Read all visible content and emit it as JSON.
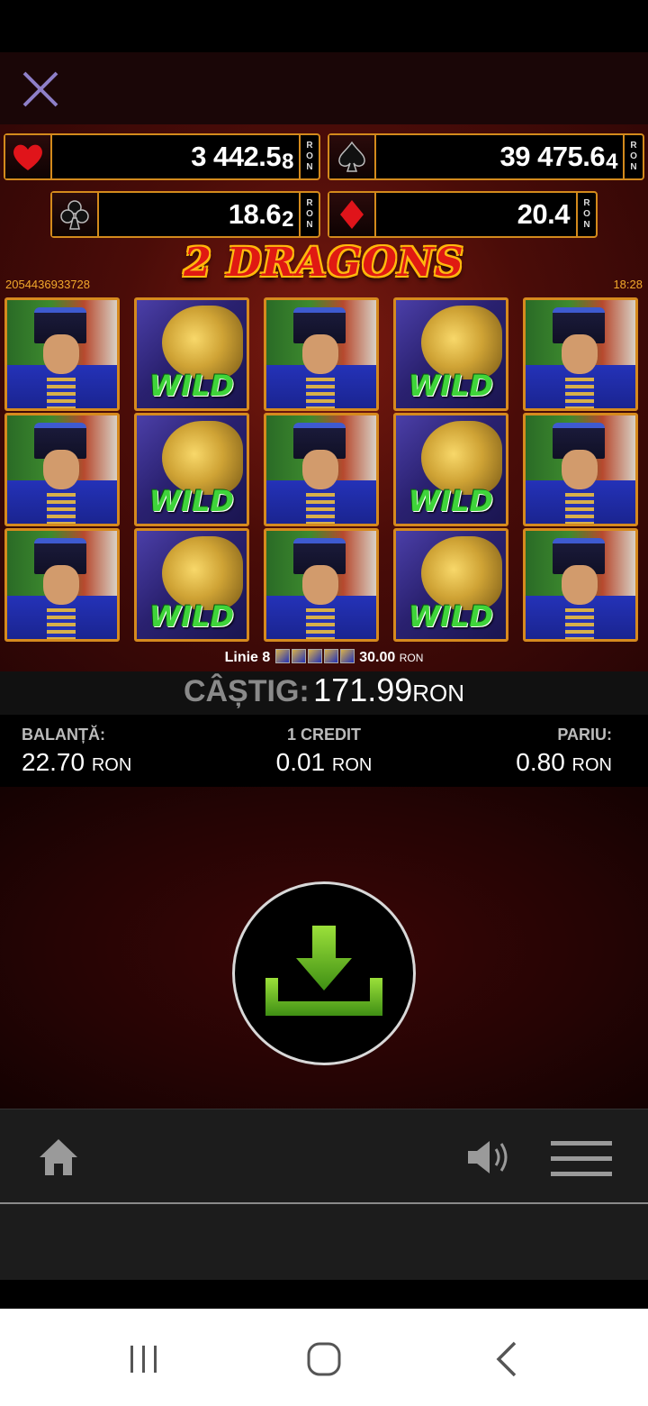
{
  "icons": {
    "close": "close-icon",
    "heart": "heart-icon",
    "spade": "spade-icon",
    "club": "club-icon",
    "diamond": "diamond-icon",
    "download": "download-icon",
    "home": "home-icon",
    "sound": "speaker-icon",
    "menu": "hamburger-menu-icon",
    "recents": "recents-icon",
    "android_home": "circle-home-icon",
    "back": "back-chevron-icon"
  },
  "jackpots": {
    "heart": {
      "main": "3 442.5",
      "tail": "8"
    },
    "spade": {
      "main": "39 475.6",
      "tail": "4"
    },
    "club": {
      "main": "18.6",
      "tail": "2"
    },
    "diamond": {
      "main": "20.4",
      "tail": ""
    },
    "currency": [
      "R",
      "O",
      "N"
    ]
  },
  "game": {
    "logo": "2 DRAGONS",
    "round_id": "2054436933728",
    "time": "18:28",
    "wild_label": "WILD",
    "reels": [
      [
        "mandarin",
        "mandarin",
        "mandarin"
      ],
      [
        "wild",
        "wild",
        "wild"
      ],
      [
        "mandarin",
        "mandarin",
        "mandarin"
      ],
      [
        "wild",
        "wild",
        "wild"
      ],
      [
        "mandarin",
        "mandarin",
        "mandarin"
      ]
    ]
  },
  "win_line": {
    "label": "Linie 8",
    "amount": "30.00",
    "currency": "RON"
  },
  "win": {
    "label": "CÂȘTIG:",
    "value": "171.99",
    "currency": "RON"
  },
  "info": {
    "balance_label": "BALANȚĂ:",
    "balance_value": "22.70",
    "credit_label": "1 CREDIT",
    "credit_value": "0.01",
    "bet_label": "PARIU:",
    "bet_value": "0.80",
    "currency": "RON"
  },
  "colors": {
    "accent_gold": "#d68a1e",
    "spin_arrow": "#6dbb22",
    "wild_green": "#3fd43a"
  }
}
